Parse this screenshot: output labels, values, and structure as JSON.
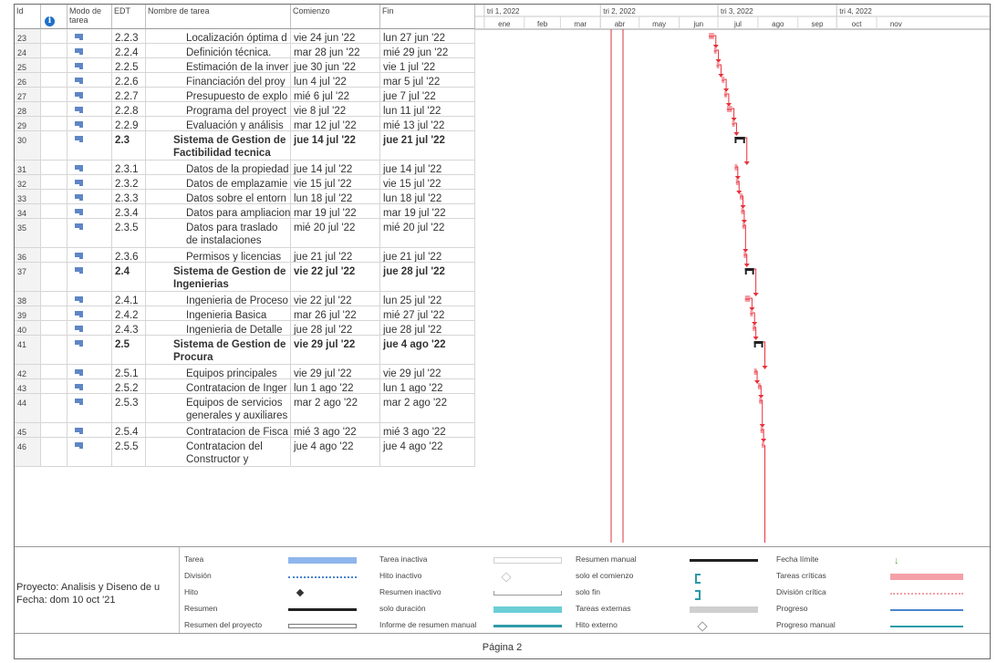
{
  "columns": {
    "id": "Id",
    "mode_line1": "Modo de",
    "mode_line2": "tarea",
    "edt": "EDT",
    "name": "Nombre de tarea",
    "start": "Comienzo",
    "end": "Fin"
  },
  "timescale": {
    "quarters": [
      "tri 1, 2022",
      "tri 2, 2022",
      "tri 3, 2022",
      "tri 4, 2022"
    ],
    "months": [
      "ene",
      "feb",
      "mar",
      "abr",
      "may",
      "jun",
      "jul",
      "ago",
      "sep",
      "oct",
      "nov"
    ]
  },
  "tasks": [
    {
      "id": "23",
      "edt": "2.2.3",
      "name": "Localización óptima d",
      "start": "vie 24 jun '22",
      "end": "lun 27 jun '22",
      "summary": false,
      "s": "2022-06-24",
      "e": "2022-06-27"
    },
    {
      "id": "24",
      "edt": "2.2.4",
      "name": "Definición técnica.",
      "start": "mar 28 jun '22",
      "end": "mié 29 jun '22",
      "summary": false,
      "s": "2022-06-28",
      "e": "2022-06-29"
    },
    {
      "id": "25",
      "edt": "2.2.5",
      "name": "Estimación de la inver",
      "start": "jue 30 jun '22",
      "end": "vie 1 jul '22",
      "summary": false,
      "s": "2022-06-30",
      "e": "2022-07-01"
    },
    {
      "id": "26",
      "edt": "2.2.6",
      "name": "Financiación del proy",
      "start": "lun 4 jul '22",
      "end": "mar 5 jul '22",
      "summary": false,
      "s": "2022-07-04",
      "e": "2022-07-05"
    },
    {
      "id": "27",
      "edt": "2.2.7",
      "name": "Presupuesto de explo",
      "start": "mié 6 jul '22",
      "end": "jue 7 jul '22",
      "summary": false,
      "s": "2022-07-06",
      "e": "2022-07-07"
    },
    {
      "id": "28",
      "edt": "2.2.8",
      "name": "Programa del proyect",
      "start": "vie 8 jul '22",
      "end": "lun 11 jul '22",
      "summary": false,
      "s": "2022-07-08",
      "e": "2022-07-11"
    },
    {
      "id": "29",
      "edt": "2.2.9",
      "name": "Evaluación y análisis",
      "start": "mar 12 jul '22",
      "end": "mié 13 jul '22",
      "summary": false,
      "s": "2022-07-12",
      "e": "2022-07-13"
    },
    {
      "id": "30",
      "edt": "2.3",
      "name": "Sistema de Gestion de Factibilidad tecnica",
      "start": "jue 14 jul '22",
      "end": "jue 21 jul '22",
      "summary": true,
      "s": "2022-07-14",
      "e": "2022-07-21"
    },
    {
      "id": "31",
      "edt": "2.3.1",
      "name": "Datos de la propiedad",
      "start": "jue 14 jul '22",
      "end": "jue 14 jul '22",
      "summary": false,
      "s": "2022-07-14",
      "e": "2022-07-14"
    },
    {
      "id": "32",
      "edt": "2.3.2",
      "name": "Datos de emplazamie",
      "start": "vie 15 jul '22",
      "end": "vie 15 jul '22",
      "summary": false,
      "s": "2022-07-15",
      "e": "2022-07-15"
    },
    {
      "id": "33",
      "edt": "2.3.3",
      "name": "Datos sobre el entorn",
      "start": "lun 18 jul '22",
      "end": "lun 18 jul '22",
      "summary": false,
      "s": "2022-07-18",
      "e": "2022-07-18"
    },
    {
      "id": "34",
      "edt": "2.3.4",
      "name": "Datos para ampliacion de",
      "start": "mar 19 jul '22",
      "end": "mar 19 jul '22",
      "summary": false,
      "s": "2022-07-19",
      "e": "2022-07-19"
    },
    {
      "id": "35",
      "edt": "2.3.5",
      "name": "Datos para traslado de instalaciones",
      "start": "mié 20 jul '22",
      "end": "mié 20 jul '22",
      "summary": false,
      "s": "2022-07-20",
      "e": "2022-07-20"
    },
    {
      "id": "36",
      "edt": "2.3.6",
      "name": "Permisos y licencias",
      "start": "jue 21 jul '22",
      "end": "jue 21 jul '22",
      "summary": false,
      "s": "2022-07-21",
      "e": "2022-07-21"
    },
    {
      "id": "37",
      "edt": "2.4",
      "name": "Sistema de Gestion de Ingenierias",
      "start": "vie 22 jul '22",
      "end": "jue 28 jul '22",
      "summary": true,
      "s": "2022-07-22",
      "e": "2022-07-28"
    },
    {
      "id": "38",
      "edt": "2.4.1",
      "name": "Ingenieria de Proceso",
      "start": "vie 22 jul '22",
      "end": "lun 25 jul '22",
      "summary": false,
      "s": "2022-07-22",
      "e": "2022-07-25"
    },
    {
      "id": "39",
      "edt": "2.4.2",
      "name": "Ingenieria Basica",
      "start": "mar 26 jul '22",
      "end": "mié 27 jul '22",
      "summary": false,
      "s": "2022-07-26",
      "e": "2022-07-27"
    },
    {
      "id": "40",
      "edt": "2.4.3",
      "name": "Ingenieria de Detalle",
      "start": "jue 28 jul '22",
      "end": "jue 28 jul '22",
      "summary": false,
      "s": "2022-07-28",
      "e": "2022-07-28"
    },
    {
      "id": "41",
      "edt": "2.5",
      "name": "Sistema de Gestion de Procura",
      "start": "vie 29 jul '22",
      "end": "jue 4 ago '22",
      "summary": true,
      "s": "2022-07-29",
      "e": "2022-08-04"
    },
    {
      "id": "42",
      "edt": "2.5.1",
      "name": "Equipos principales",
      "start": "vie 29 jul '22",
      "end": "vie 29 jul '22",
      "summary": false,
      "s": "2022-07-29",
      "e": "2022-07-29"
    },
    {
      "id": "43",
      "edt": "2.5.2",
      "name": "Contratacion de Inger",
      "start": "lun 1 ago '22",
      "end": "lun 1 ago '22",
      "summary": false,
      "s": "2022-08-01",
      "e": "2022-08-01"
    },
    {
      "id": "44",
      "edt": "2.5.3",
      "name": "Equipos de servicios generales y auxiliares",
      "start": "mar 2 ago '22",
      "end": "mar 2 ago '22",
      "summary": false,
      "s": "2022-08-02",
      "e": "2022-08-02"
    },
    {
      "id": "45",
      "edt": "2.5.4",
      "name": "Contratacion de Fisca",
      "start": "mié 3 ago '22",
      "end": "mié 3 ago '22",
      "summary": false,
      "s": "2022-08-03",
      "e": "2022-08-03"
    },
    {
      "id": "46",
      "edt": "2.5.5",
      "name": "Contratacion del Constructor y",
      "start": "jue 4 ago '22",
      "end": "jue 4 ago '22",
      "summary": false,
      "s": "2022-08-04",
      "e": "2022-08-04"
    }
  ],
  "project": {
    "name": "Proyecto: Analisis y Diseno de u",
    "date": "Fecha: dom 10 oct '21"
  },
  "legend": [
    {
      "label": "Tarea",
      "sym": "task"
    },
    {
      "label": "División",
      "sym": "split"
    },
    {
      "label": "Hito",
      "sym": "milestone"
    },
    {
      "label": "Resumen",
      "sym": "summary"
    },
    {
      "label": "Resumen del proyecto",
      "sym": "projsummary"
    },
    {
      "label": "Tarea inactiva",
      "sym": "inactive-task"
    },
    {
      "label": "Hito inactivo",
      "sym": "inactive-milestone"
    },
    {
      "label": "Resumen inactivo",
      "sym": "inactive-summary"
    },
    {
      "label": "solo duración",
      "sym": "duration-only"
    },
    {
      "label": "Informe de resumen manual",
      "sym": "manual-summary-rollup"
    },
    {
      "label": "Resumen manual",
      "sym": "manual-summary"
    },
    {
      "label": "solo el comienzo",
      "sym": "start-only"
    },
    {
      "label": "solo fin",
      "sym": "finish-only"
    },
    {
      "label": "Tareas externas",
      "sym": "external-tasks"
    },
    {
      "label": "Hito externo",
      "sym": "external-milestone"
    },
    {
      "label": "Fecha límite",
      "sym": "deadline"
    },
    {
      "label": "Tareas críticas",
      "sym": "critical"
    },
    {
      "label": "División crítica",
      "sym": "critical-split"
    },
    {
      "label": "Progreso",
      "sym": "progress"
    },
    {
      "label": "Progreso manual",
      "sym": "manual-progress"
    }
  ],
  "footer": {
    "page": "Página 2"
  },
  "colors": {
    "critical": "#f4a0a8",
    "critical_line": "#e8303a",
    "summary": "#222222",
    "today_line": "#d9343c",
    "task": "#8fb6ec",
    "duration_only": "#6bcfd6",
    "progress": "#4a84d0",
    "deadline": "#56b23a"
  }
}
